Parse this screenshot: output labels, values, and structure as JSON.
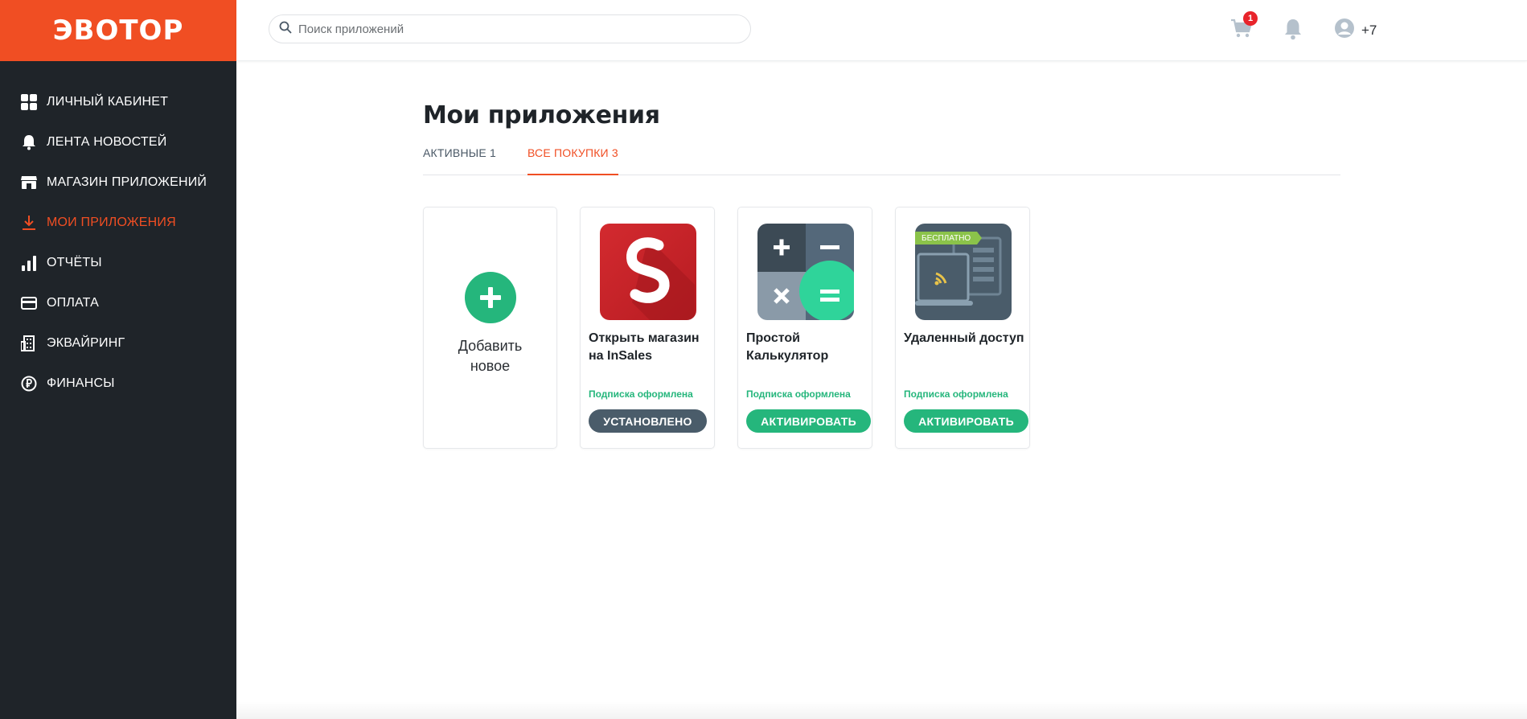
{
  "brand": {
    "logo": "ЭВОТОР",
    "color": "#f04e23"
  },
  "sidebar": {
    "items": [
      {
        "label": "ЛИЧНЫЙ КАБИНЕТ",
        "icon": "dashboard-icon",
        "active": false
      },
      {
        "label": "ЛЕНТА НОВОСТЕЙ",
        "icon": "bell-icon",
        "active": false
      },
      {
        "label": "МАГАЗИН ПРИЛОЖЕНИЙ",
        "icon": "store-icon",
        "active": false
      },
      {
        "label": "МОИ ПРИЛОЖЕНИЯ",
        "icon": "download-icon",
        "active": true
      },
      {
        "label": "ОТЧЁТЫ",
        "icon": "bar-chart-icon",
        "active": false
      },
      {
        "label": "ОПЛАТА",
        "icon": "credit-card-icon",
        "active": false
      },
      {
        "label": "ЭКВАЙРИНГ",
        "icon": "building-icon",
        "active": false
      },
      {
        "label": "ФИНАНСЫ",
        "icon": "ruble-icon",
        "active": false
      }
    ]
  },
  "header": {
    "search_placeholder": "Поиск приложений",
    "cart_count": "1",
    "user_label": "+7"
  },
  "main": {
    "title": "Мои приложения",
    "tabs": [
      {
        "label": "АКТИВНЫЕ 1",
        "active": false
      },
      {
        "label": "ВСЕ ПОКУПКИ 3",
        "active": true
      }
    ],
    "add_card": {
      "label": "Добавить новое"
    },
    "apps": [
      {
        "name": "Открыть магазин на InSales",
        "status": "Подписка оформлена",
        "button": "УСТАНОВЛЕНО",
        "icon": "insales-logo-icon"
      },
      {
        "name": "Простой Калькулятор",
        "status": "Подписка оформлена",
        "button": "АКТИВИРОВАТЬ",
        "icon": "calculator-icon"
      },
      {
        "name": "Удаленный доступ",
        "status": "Подписка оформлена",
        "button": "АКТИВИРОВАТЬ",
        "icon": "remote-access-icon",
        "badge": "БЕСПЛАТНО"
      }
    ]
  },
  "colors": {
    "sidebar_bg": "#1f2429",
    "accent": "#f04e23",
    "green": "#25b67c",
    "installed": "#4a5c6a"
  }
}
